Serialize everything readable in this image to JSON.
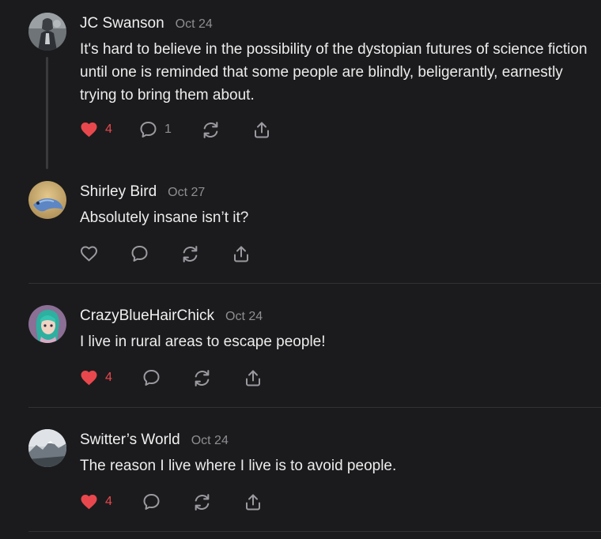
{
  "comments": [
    {
      "author": "JC Swanson",
      "date": "Oct 24",
      "text": "It's hard to believe in the possibility of the dystopian futures of science fiction until one is reminded that some people are blindly, beligerantly, earnestly trying to bring them about.",
      "likes": "4",
      "liked": true,
      "replies": "1",
      "avatar": "statue-photo-avatar"
    },
    {
      "author": "Shirley Bird",
      "date": "Oct 27",
      "text": "Absolutely insane isn’t it?",
      "liked": false,
      "avatar": "bird-illustration-avatar"
    },
    {
      "author": "CrazyBlueHairChick",
      "date": "Oct 24",
      "text": "I live in rural areas to escape people!",
      "likes": "4",
      "liked": true,
      "avatar": "blue-hair-character-avatar"
    },
    {
      "author": "Switter’s World",
      "date": "Oct 24",
      "text": "The reason I live where I live is to avoid people.",
      "likes": "4",
      "liked": true,
      "avatar": "mountain-landscape-avatar"
    }
  ],
  "colors": {
    "background": "#1b1b1d",
    "liked_heart": "#e8484d",
    "icon_gray": "#9a9aa0",
    "date_gray": "#8e8e93"
  }
}
